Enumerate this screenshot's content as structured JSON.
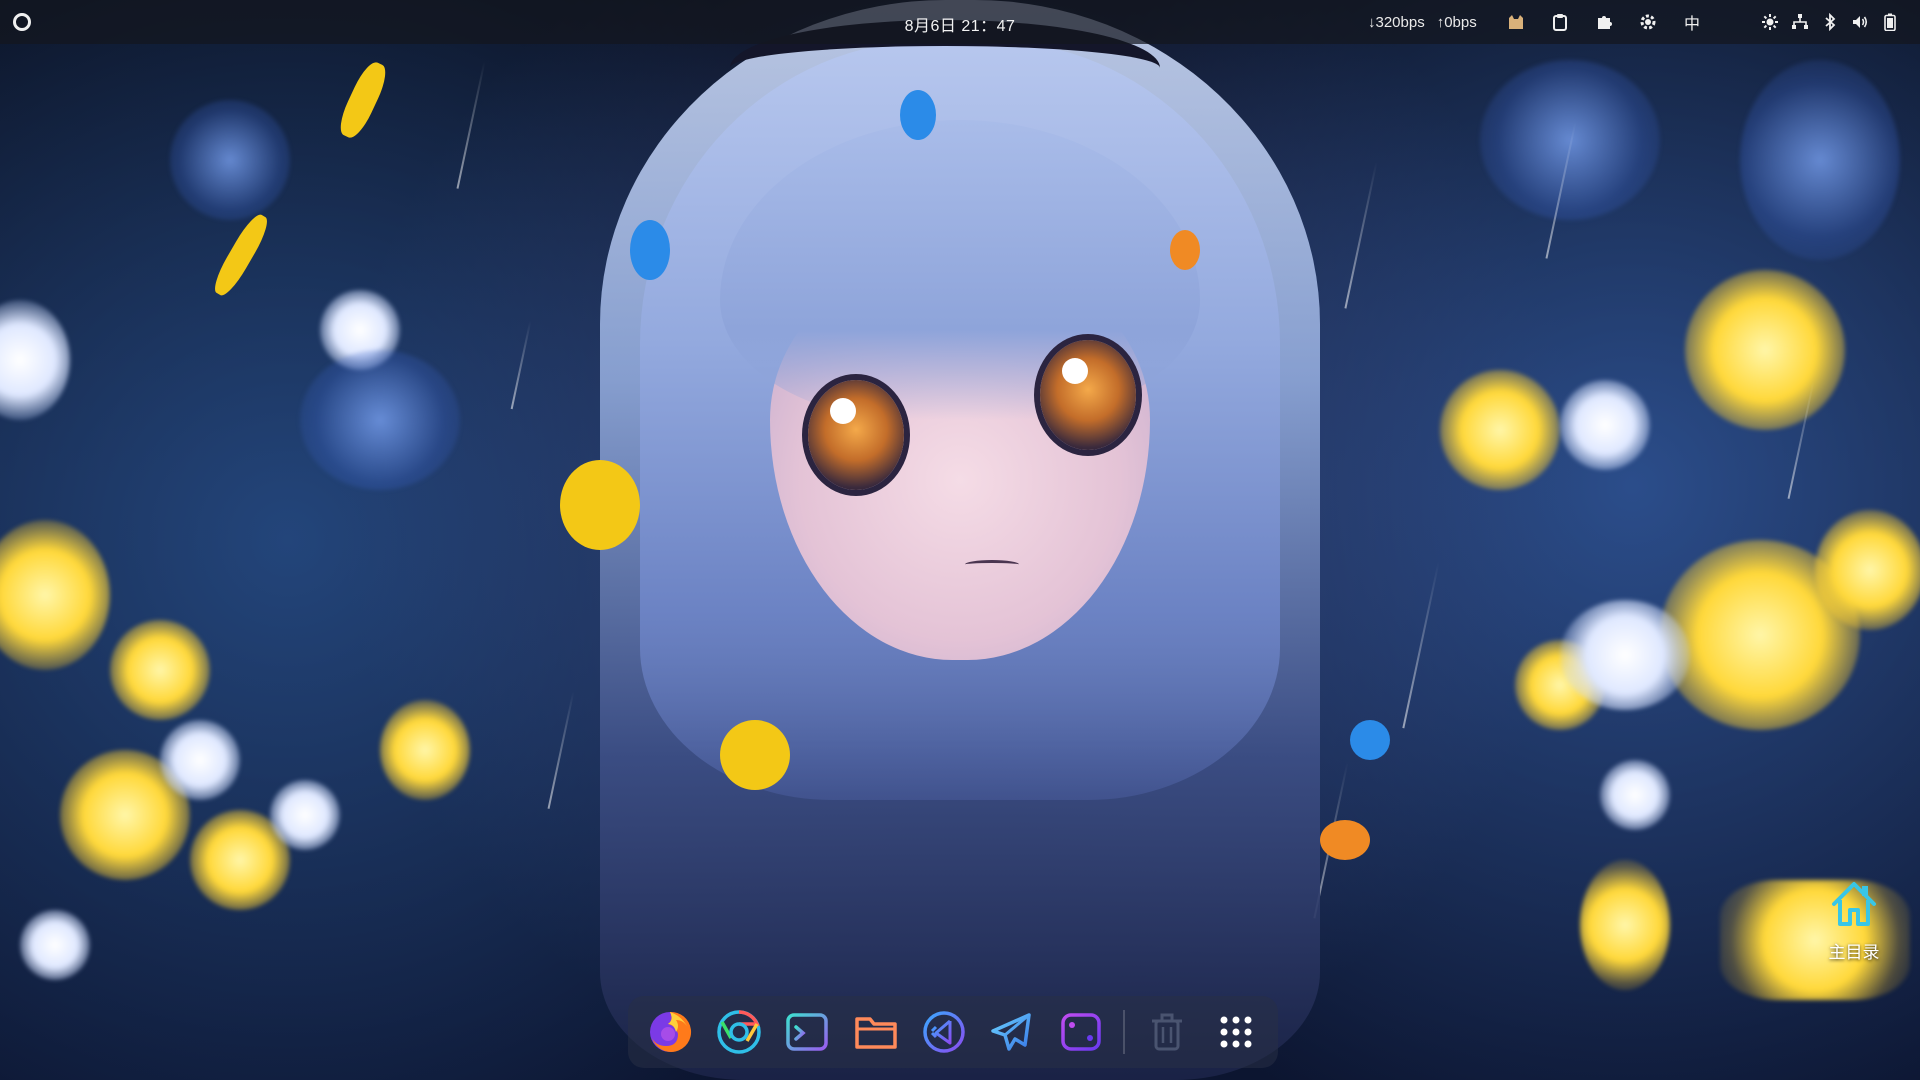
{
  "topbar": {
    "clock": "8月6日  21：47",
    "net_down": "↓320bps",
    "net_up": "↑0bps",
    "ime": "中",
    "icons": [
      "activities-icon",
      "cat-indicator-icon",
      "clipboard-icon",
      "extensions-puzzle-icon",
      "settings-gear-icon",
      "brightness-icon",
      "network-icon",
      "bluetooth-icon",
      "volume-icon",
      "battery-icon"
    ]
  },
  "desktop": {
    "home_label": "主目录",
    "home_icon": "home-folder-icon"
  },
  "dock": {
    "items": [
      {
        "name": "firefox",
        "icon": "firefox-icon"
      },
      {
        "name": "chrome",
        "icon": "chrome-icon"
      },
      {
        "name": "terminal",
        "icon": "terminal-icon"
      },
      {
        "name": "files",
        "icon": "folder-icon"
      },
      {
        "name": "vscode",
        "icon": "vscode-icon"
      },
      {
        "name": "telegram",
        "icon": "telegram-icon"
      },
      {
        "name": "switch",
        "icon": "switch-icon"
      },
      {
        "name": "trash",
        "icon": "trash-icon"
      },
      {
        "name": "app-grid",
        "icon": "app-grid-icon"
      }
    ]
  },
  "colors": {
    "accent_cyan": "#39c6e6",
    "bokeh_yellow": "#ffd83a"
  }
}
